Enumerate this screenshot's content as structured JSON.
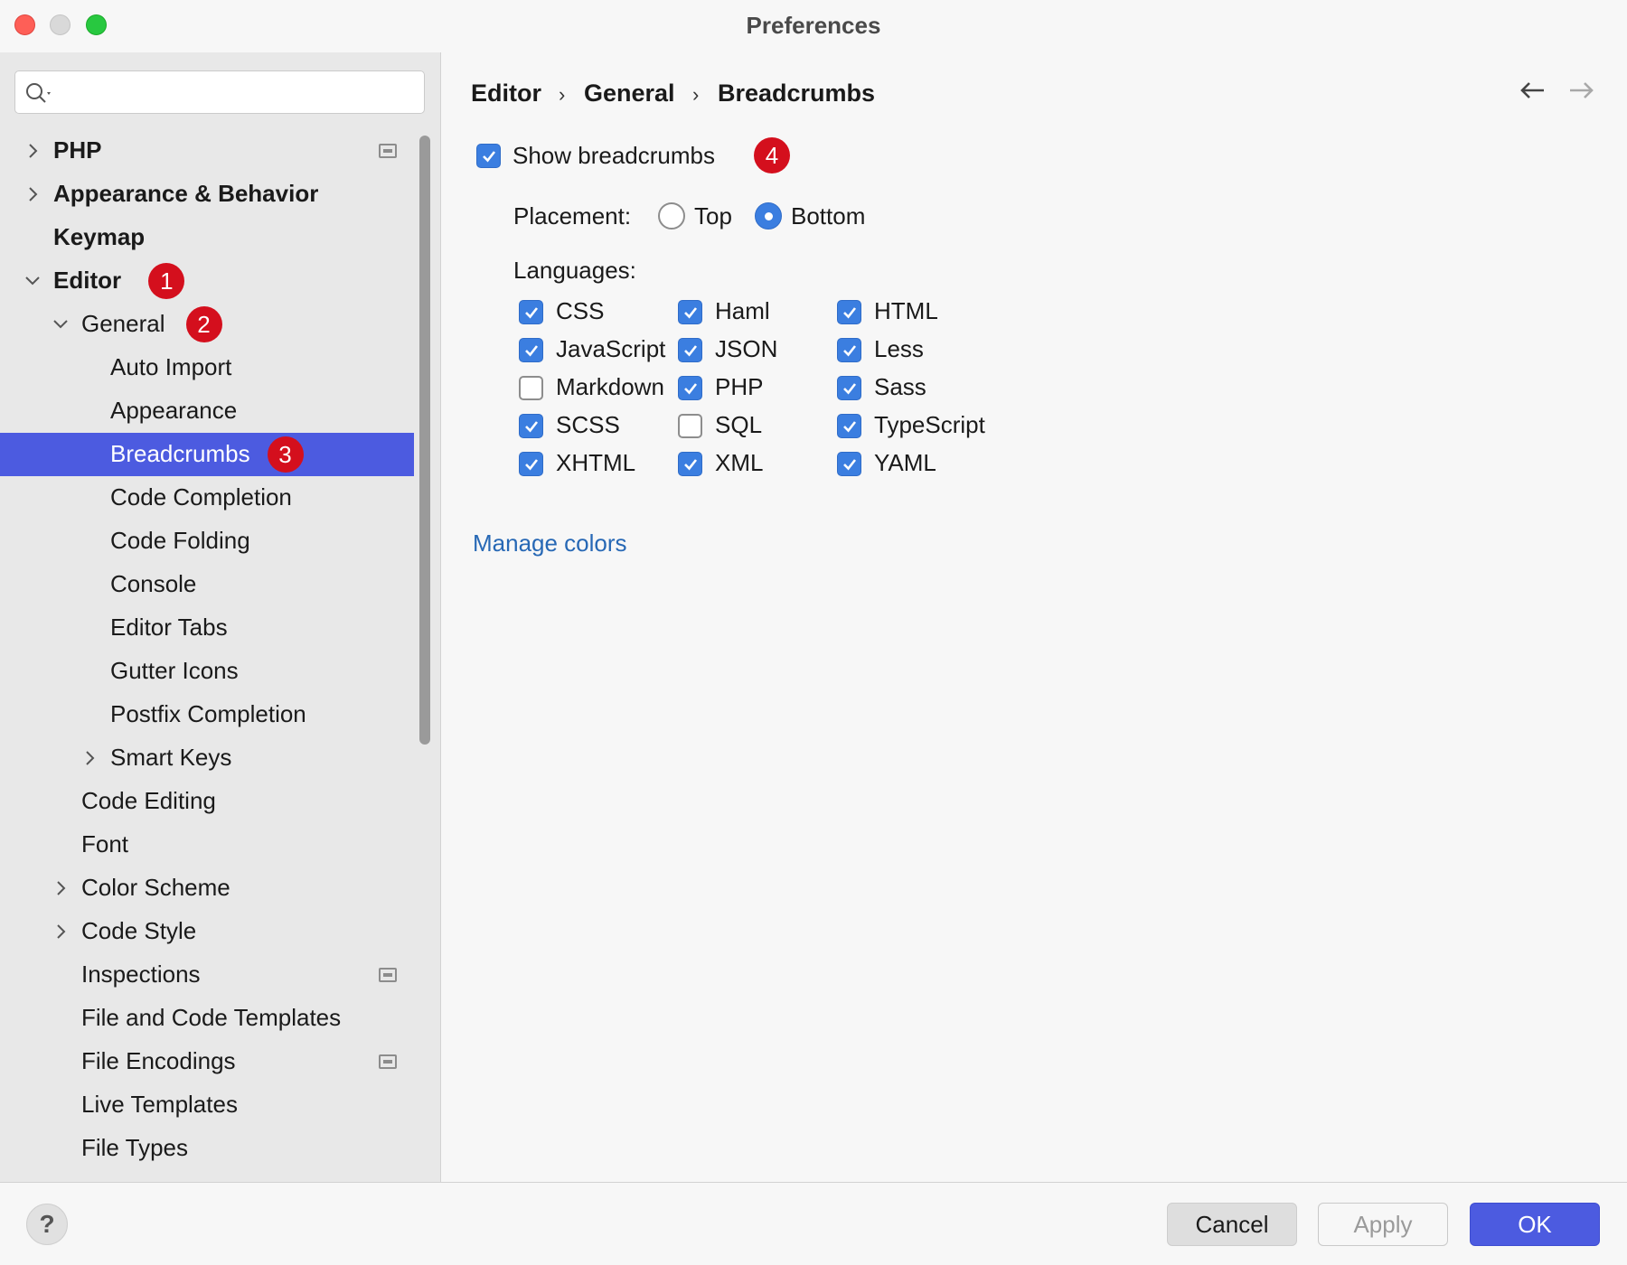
{
  "window": {
    "title": "Preferences"
  },
  "search": {
    "placeholder": ""
  },
  "sidebar": {
    "items": [
      {
        "label": "PHP",
        "level": 0,
        "bold": true,
        "expander": "collapsed",
        "project_icon": true
      },
      {
        "label": "Appearance & Behavior",
        "level": 0,
        "bold": true,
        "expander": "collapsed"
      },
      {
        "label": "Keymap",
        "level": 0,
        "bold": true,
        "expander": "none"
      },
      {
        "label": "Editor",
        "level": 0,
        "bold": true,
        "expander": "expanded",
        "badge": "1"
      },
      {
        "label": "General",
        "level": 1,
        "expander": "expanded",
        "badge": "2"
      },
      {
        "label": "Auto Import",
        "level": 2,
        "expander": "none"
      },
      {
        "label": "Appearance",
        "level": 2,
        "expander": "none"
      },
      {
        "label": "Breadcrumbs",
        "level": 2,
        "expander": "none",
        "selected": true,
        "badge": "3"
      },
      {
        "label": "Code Completion",
        "level": 2,
        "expander": "none"
      },
      {
        "label": "Code Folding",
        "level": 2,
        "expander": "none"
      },
      {
        "label": "Console",
        "level": 2,
        "expander": "none"
      },
      {
        "label": "Editor Tabs",
        "level": 2,
        "expander": "none"
      },
      {
        "label": "Gutter Icons",
        "level": 2,
        "expander": "none"
      },
      {
        "label": "Postfix Completion",
        "level": 2,
        "expander": "none"
      },
      {
        "label": "Smart Keys",
        "level": 2,
        "expander": "collapsed"
      },
      {
        "label": "Code Editing",
        "level": 1,
        "expander": "none"
      },
      {
        "label": "Font",
        "level": 1,
        "expander": "none"
      },
      {
        "label": "Color Scheme",
        "level": 1,
        "expander": "collapsed"
      },
      {
        "label": "Code Style",
        "level": 1,
        "expander": "collapsed"
      },
      {
        "label": "Inspections",
        "level": 1,
        "expander": "none",
        "project_icon": true
      },
      {
        "label": "File and Code Templates",
        "level": 1,
        "expander": "none"
      },
      {
        "label": "File Encodings",
        "level": 1,
        "expander": "none",
        "project_icon": true
      },
      {
        "label": "Live Templates",
        "level": 1,
        "expander": "none"
      },
      {
        "label": "File Types",
        "level": 1,
        "expander": "none"
      }
    ]
  },
  "breadcrumb": {
    "items": [
      "Editor",
      "General",
      "Breadcrumbs"
    ],
    "separator": "›"
  },
  "settings": {
    "show_breadcrumbs": {
      "label": "Show breadcrumbs",
      "checked": true,
      "badge": "4"
    },
    "placement": {
      "label": "Placement:",
      "options": [
        {
          "label": "Top",
          "selected": false
        },
        {
          "label": "Bottom",
          "selected": true
        }
      ]
    },
    "languages": {
      "label": "Languages:",
      "items": [
        {
          "label": "CSS",
          "checked": true
        },
        {
          "label": "Haml",
          "checked": true
        },
        {
          "label": "HTML",
          "checked": true
        },
        {
          "label": "JavaScript",
          "checked": true
        },
        {
          "label": "JSON",
          "checked": true
        },
        {
          "label": "Less",
          "checked": true
        },
        {
          "label": "Markdown",
          "checked": false
        },
        {
          "label": "PHP",
          "checked": true
        },
        {
          "label": "Sass",
          "checked": true
        },
        {
          "label": "SCSS",
          "checked": true
        },
        {
          "label": "SQL",
          "checked": false
        },
        {
          "label": "TypeScript",
          "checked": true
        },
        {
          "label": "XHTML",
          "checked": true
        },
        {
          "label": "XML",
          "checked": true
        },
        {
          "label": "YAML",
          "checked": true
        }
      ]
    },
    "manage_colors": "Manage colors"
  },
  "footer": {
    "help": "?",
    "cancel": "Cancel",
    "apply": "Apply",
    "ok": "OK"
  },
  "colors": {
    "accent": "#4c5be0",
    "checkbox": "#3b7ee0",
    "badge": "#d40f1d",
    "link": "#2768b5"
  },
  "icons": [
    "search-icon",
    "back-arrow-icon",
    "forward-arrow-icon",
    "chevron-right-icon",
    "chevron-down-icon",
    "project-scope-icon",
    "help-icon"
  ]
}
